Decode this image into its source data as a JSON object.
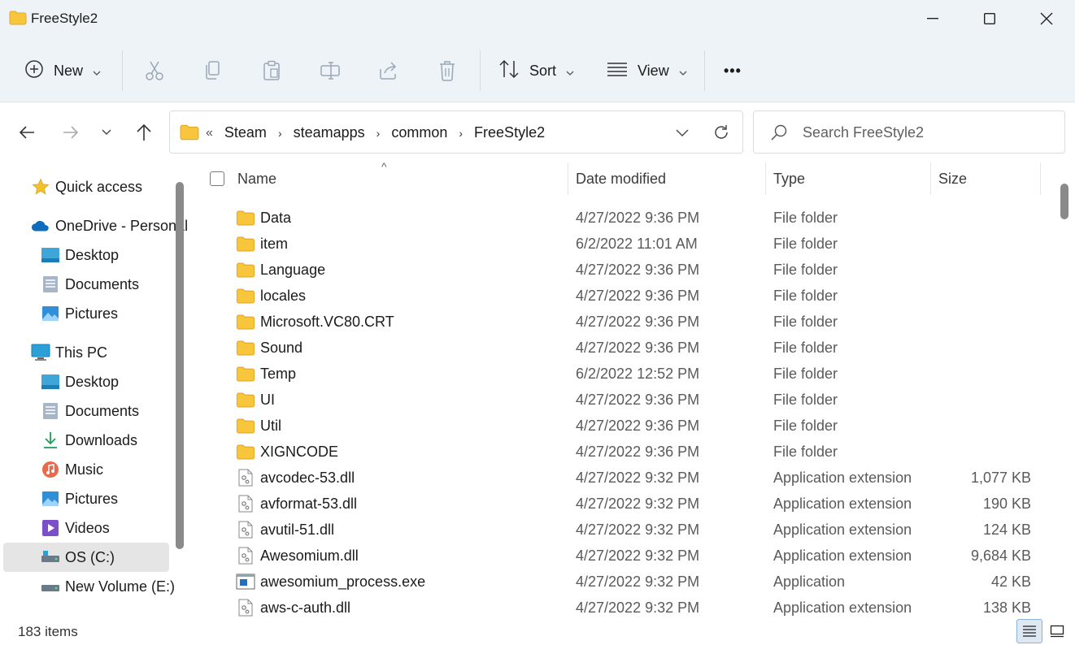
{
  "window": {
    "title": "FreeStyle2"
  },
  "toolbar": {
    "new_label": "New",
    "sort_label": "Sort",
    "view_label": "View",
    "more_label": "•••"
  },
  "address": {
    "overflow": "«",
    "crumbs": [
      "Steam",
      "steamapps",
      "common",
      "FreeStyle2"
    ]
  },
  "search": {
    "placeholder": "Search FreeStyle2"
  },
  "sidebar": {
    "items": [
      {
        "label": "Quick access",
        "icon": "star-icon"
      },
      {
        "label": "OneDrive - Personal",
        "icon": "onedrive-cloud-icon"
      },
      {
        "label": "Desktop",
        "icon": "desktop-icon"
      },
      {
        "label": "Documents",
        "icon": "documents-icon"
      },
      {
        "label": "Pictures",
        "icon": "pictures-icon"
      },
      {
        "label": "This PC",
        "icon": "this-pc-icon"
      },
      {
        "label": "Desktop",
        "icon": "desktop-icon"
      },
      {
        "label": "Documents",
        "icon": "documents-icon"
      },
      {
        "label": "Downloads",
        "icon": "downloads-icon"
      },
      {
        "label": "Music",
        "icon": "music-icon"
      },
      {
        "label": "Pictures",
        "icon": "pictures-icon"
      },
      {
        "label": "Videos",
        "icon": "videos-icon"
      },
      {
        "label": "OS (C:)",
        "icon": "drive-c-icon"
      },
      {
        "label": "New Volume (E:)",
        "icon": "drive-e-icon"
      }
    ]
  },
  "columns": {
    "name": "Name",
    "date": "Date modified",
    "type": "Type",
    "size": "Size"
  },
  "files": [
    {
      "name": "Data",
      "date": "4/27/2022 9:36 PM",
      "type": "File folder",
      "size": "",
      "kind": "folder"
    },
    {
      "name": "item",
      "date": "6/2/2022 11:01 AM",
      "type": "File folder",
      "size": "",
      "kind": "folder"
    },
    {
      "name": "Language",
      "date": "4/27/2022 9:36 PM",
      "type": "File folder",
      "size": "",
      "kind": "folder"
    },
    {
      "name": "locales",
      "date": "4/27/2022 9:36 PM",
      "type": "File folder",
      "size": "",
      "kind": "folder"
    },
    {
      "name": "Microsoft.VC80.CRT",
      "date": "4/27/2022 9:36 PM",
      "type": "File folder",
      "size": "",
      "kind": "folder"
    },
    {
      "name": "Sound",
      "date": "4/27/2022 9:36 PM",
      "type": "File folder",
      "size": "",
      "kind": "folder"
    },
    {
      "name": "Temp",
      "date": "6/2/2022 12:52 PM",
      "type": "File folder",
      "size": "",
      "kind": "folder"
    },
    {
      "name": "UI",
      "date": "4/27/2022 9:36 PM",
      "type": "File folder",
      "size": "",
      "kind": "folder"
    },
    {
      "name": "Util",
      "date": "4/27/2022 9:36 PM",
      "type": "File folder",
      "size": "",
      "kind": "folder"
    },
    {
      "name": "XIGNCODE",
      "date": "4/27/2022 9:36 PM",
      "type": "File folder",
      "size": "",
      "kind": "folder"
    },
    {
      "name": "avcodec-53.dll",
      "date": "4/27/2022 9:32 PM",
      "type": "Application extension",
      "size": "1,077 KB",
      "kind": "dll"
    },
    {
      "name": "avformat-53.dll",
      "date": "4/27/2022 9:32 PM",
      "type": "Application extension",
      "size": "190 KB",
      "kind": "dll"
    },
    {
      "name": "avutil-51.dll",
      "date": "4/27/2022 9:32 PM",
      "type": "Application extension",
      "size": "124 KB",
      "kind": "dll"
    },
    {
      "name": "Awesomium.dll",
      "date": "4/27/2022 9:32 PM",
      "type": "Application extension",
      "size": "9,684 KB",
      "kind": "dll"
    },
    {
      "name": "awesomium_process.exe",
      "date": "4/27/2022 9:32 PM",
      "type": "Application",
      "size": "42 KB",
      "kind": "exe"
    },
    {
      "name": "aws-c-auth.dll",
      "date": "4/27/2022 9:32 PM",
      "type": "Application extension",
      "size": "138 KB",
      "kind": "dll"
    }
  ],
  "status": {
    "item_count": "183 items"
  },
  "colors": {
    "folder": "#f8c63d",
    "accent": "#0067c0",
    "chrome": "#eef3f8"
  }
}
